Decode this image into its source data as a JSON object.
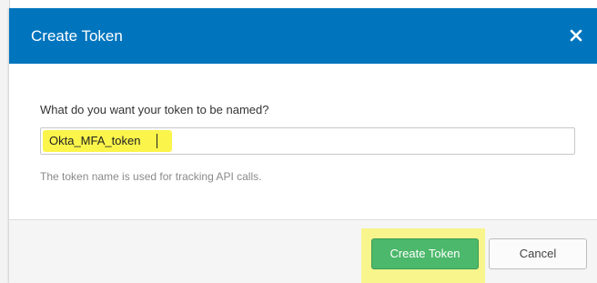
{
  "dialog": {
    "title": "Create Token",
    "close_icon": "close-icon",
    "header_color": "#0075be"
  },
  "form": {
    "label": "What do you want your token to be named?",
    "token_name_value": "Okta_MFA_token",
    "help_text": "The token name is used for tracking API calls."
  },
  "footer": {
    "create_label": "Create Token",
    "cancel_label": "Cancel",
    "create_color": "#4cb86b"
  }
}
